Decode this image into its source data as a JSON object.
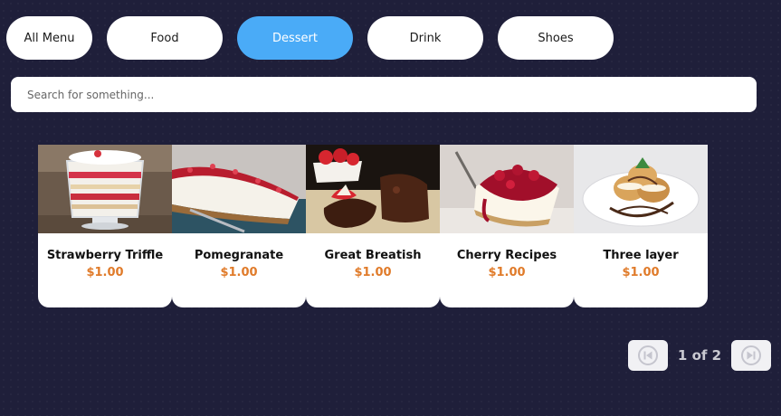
{
  "tabs": [
    {
      "label": "All Menu",
      "active": false
    },
    {
      "label": "Food",
      "active": false
    },
    {
      "label": "Dessert",
      "active": true
    },
    {
      "label": "Drink",
      "active": false
    },
    {
      "label": "Shoes",
      "active": false
    }
  ],
  "search": {
    "placeholder": "Search for something..."
  },
  "products": [
    {
      "name": "Strawberry Triffle",
      "price": "$1.00"
    },
    {
      "name": "Pomegranate",
      "price": "$1.00"
    },
    {
      "name": "Great Breatish",
      "price": "$1.00"
    },
    {
      "name": "Cherry Recipes",
      "price": "$1.00"
    },
    {
      "name": "Three layer",
      "price": "$1.00"
    }
  ],
  "pagination": {
    "label": "1 of 2",
    "prev_icon": "skip-previous-icon",
    "next_icon": "skip-next-icon"
  },
  "colors": {
    "background": "#1f1f3a",
    "active_tab": "#4aabf7",
    "price": "#e07b2a"
  }
}
